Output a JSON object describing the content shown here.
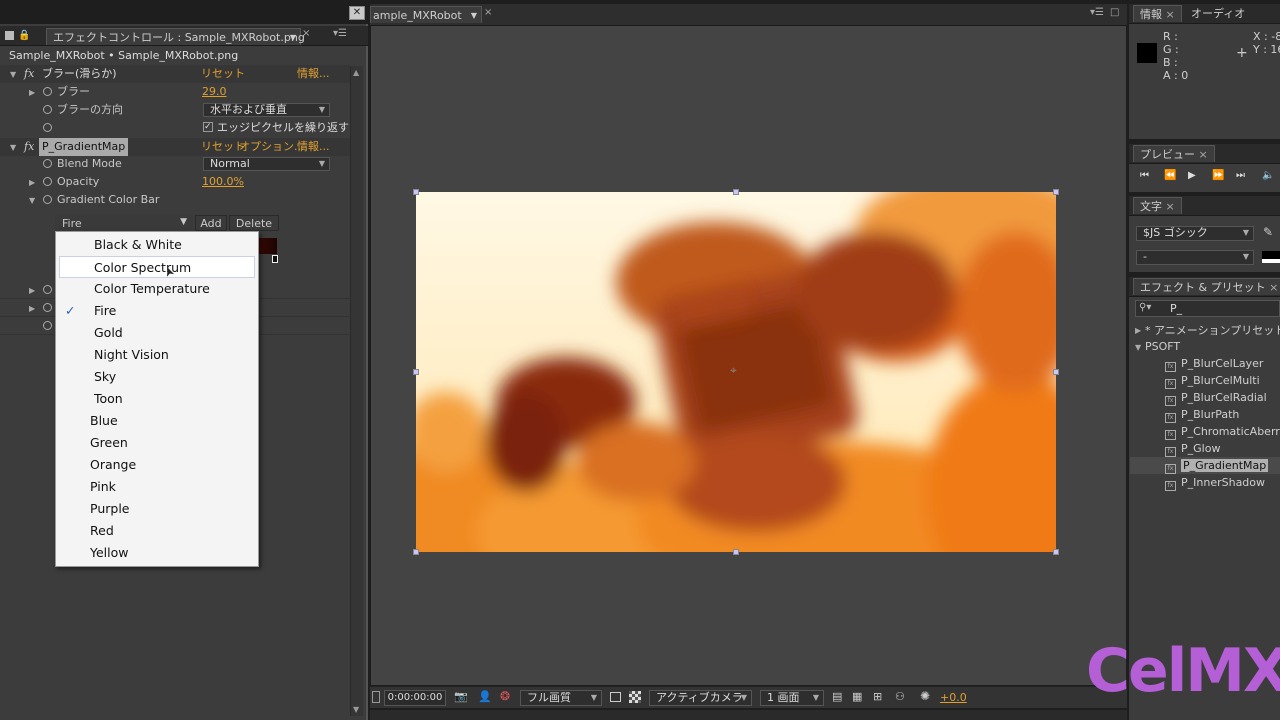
{
  "effect_panel": {
    "tab_title": "エフェクトコントロール : Sample_MXRobot.png",
    "breadcrumb": "Sample_MXRobot • Sample_MXRobot.png",
    "effects": [
      {
        "name": "ブラー(滑らか)",
        "reset": "リセット",
        "info": "情報..."
      },
      {
        "name": "P_GradientMap",
        "reset": "リセット",
        "options": "オプション...",
        "info": "情報..."
      }
    ],
    "blur": {
      "label": "ブラー",
      "value": "29.0"
    },
    "blur_dir": {
      "label": "ブラーの方向",
      "value": "水平および垂直"
    },
    "edge_pixels": {
      "label": "エッジピクセルを繰り返す",
      "checked": true
    },
    "blend_mode": {
      "label": "Blend Mode",
      "value": "Normal"
    },
    "opacity": {
      "label": "Opacity",
      "value": "100.0%"
    },
    "gradient_bar": {
      "label": "Gradient Color Bar",
      "selected": "Fire",
      "add": "Add",
      "delete": "Delete"
    }
  },
  "preset_menu": {
    "items": [
      "Black & White",
      "Color Spectrum",
      "Color Temperature",
      "Fire",
      "Gold",
      "Night Vision",
      "Sky",
      "Toon",
      "Blue",
      "Green",
      "Orange",
      "Pink",
      "Purple",
      "Red",
      "Yellow"
    ],
    "checked": "Fire",
    "hovered": "Color Spectrum"
  },
  "composition": {
    "tab_title": "ample_MXRobot",
    "timecode": "0:00:00:00",
    "resolution": "フル画質",
    "camera": "アクティブカメラ",
    "views": "1 画面",
    "exposure": "+0.0"
  },
  "info_panel": {
    "tabs": [
      "情報",
      "オーディオ"
    ],
    "rgba_labels": [
      "R :",
      "G :",
      "B :",
      "A : 0"
    ],
    "x": "X : -8",
    "y": "Y : 16"
  },
  "preview_panel": {
    "title": "プレビュー"
  },
  "text_panel": {
    "title": "文字",
    "font": "$JS ゴシック",
    "style": "-"
  },
  "effects_presets_panel": {
    "title": "エフェクト & プリセット",
    "search": "P_",
    "groups": [
      "* アニメーションプリセット",
      "PSOFT"
    ],
    "items": [
      "P_BlurCelLayer",
      "P_BlurCelMulti",
      "P_BlurCelRadial",
      "P_BlurPath",
      "P_ChromaticAberrat",
      "P_Glow",
      "P_GradientMap",
      "P_InnerShadow"
    ],
    "selected": "P_GradientMap"
  },
  "watermark": "CelMX",
  "colors": {
    "accent_orange": "#e0a030",
    "watermark_purple": "#b45fd6",
    "panel": "#3c3c3c"
  }
}
